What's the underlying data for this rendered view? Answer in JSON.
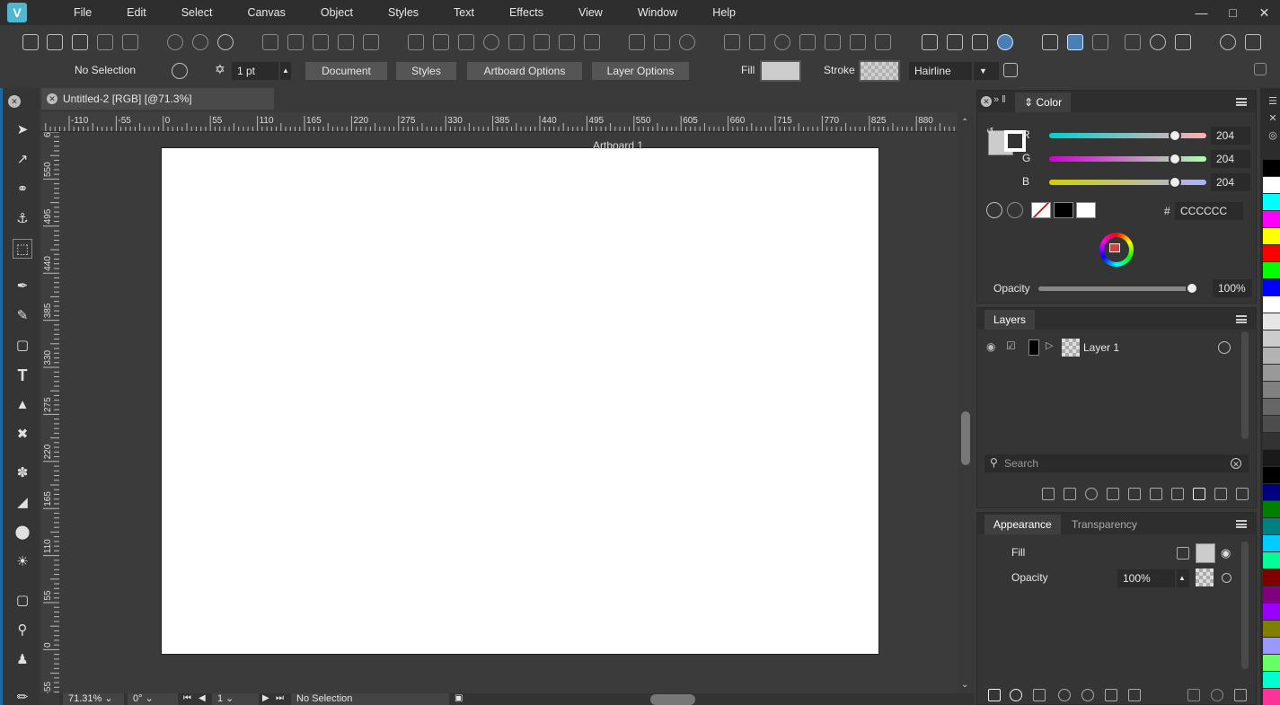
{
  "menubar": {
    "items": [
      "File",
      "Edit",
      "Select",
      "Canvas",
      "Object",
      "Styles",
      "Text",
      "Effects",
      "View",
      "Window",
      "Help"
    ],
    "window_controls": [
      "minimize-icon",
      "maximize-icon",
      "close-icon"
    ]
  },
  "props": {
    "selection": "No Selection",
    "stroke_width": "1 pt",
    "btn_document": "Document",
    "btn_styles": "Styles",
    "btn_artboard": "Artboard Options",
    "btn_layer": "Layer Options",
    "fill_label": "Fill",
    "stroke_label": "Stroke",
    "stroke_style": "Hairline",
    "fill_color": "#cccccc"
  },
  "document": {
    "tab_title": "Untitled-2 [RGB] [@71.3%]",
    "artboard_label": "Artboard 1"
  },
  "ruler": {
    "h_labels": [
      "-110",
      "-55",
      "0",
      "55",
      "110",
      "165",
      "220",
      "275",
      "330",
      "385",
      "440",
      "495",
      "550",
      "605",
      "660",
      "715",
      "770",
      "825",
      "880"
    ],
    "v_labels": [
      "6",
      "550",
      "495",
      "440",
      "385",
      "330",
      "275",
      "220",
      "165",
      "110",
      "55",
      "0",
      "-55"
    ]
  },
  "statusbar": {
    "zoom": "71.31%",
    "rotation": "0°",
    "page": "1",
    "selection": "No Selection"
  },
  "color_panel": {
    "tab": "Color",
    "r_label": "R",
    "r_value": "204",
    "g_label": "G",
    "g_value": "204",
    "b_label": "B",
    "b_value": "204",
    "hex_prefix": "#",
    "hex_value": "CCCCCC",
    "opacity_label": "Opacity",
    "opacity_value": "100%"
  },
  "layers_panel": {
    "tab": "Layers",
    "layer_name": "Layer 1",
    "search_placeholder": "Search"
  },
  "appearance_panel": {
    "tab_active": "Appearance",
    "tab_inactive": "Transparency",
    "fill_label": "Fill",
    "opacity_label": "Opacity",
    "opacity_value": "100%"
  },
  "palette_colors": [
    "#000000",
    "#ffffff",
    "#00ffff",
    "#ff00ff",
    "#ffff00",
    "#ff0000",
    "#00ff00",
    "#0000ff",
    "#ffffff",
    "#e6e6e6",
    "#cccccc",
    "#b3b3b3",
    "#999999",
    "#808080",
    "#666666",
    "#4d4d4d",
    "#333333",
    "#1a1a1a",
    "#000000",
    "#000080",
    "#008000",
    "#008080",
    "#00ccff",
    "#00ff99",
    "#800000",
    "#800080",
    "#9900ff",
    "#808000",
    "#9999ff",
    "#66ff66",
    "#00ffcc",
    "#ff3399"
  ]
}
